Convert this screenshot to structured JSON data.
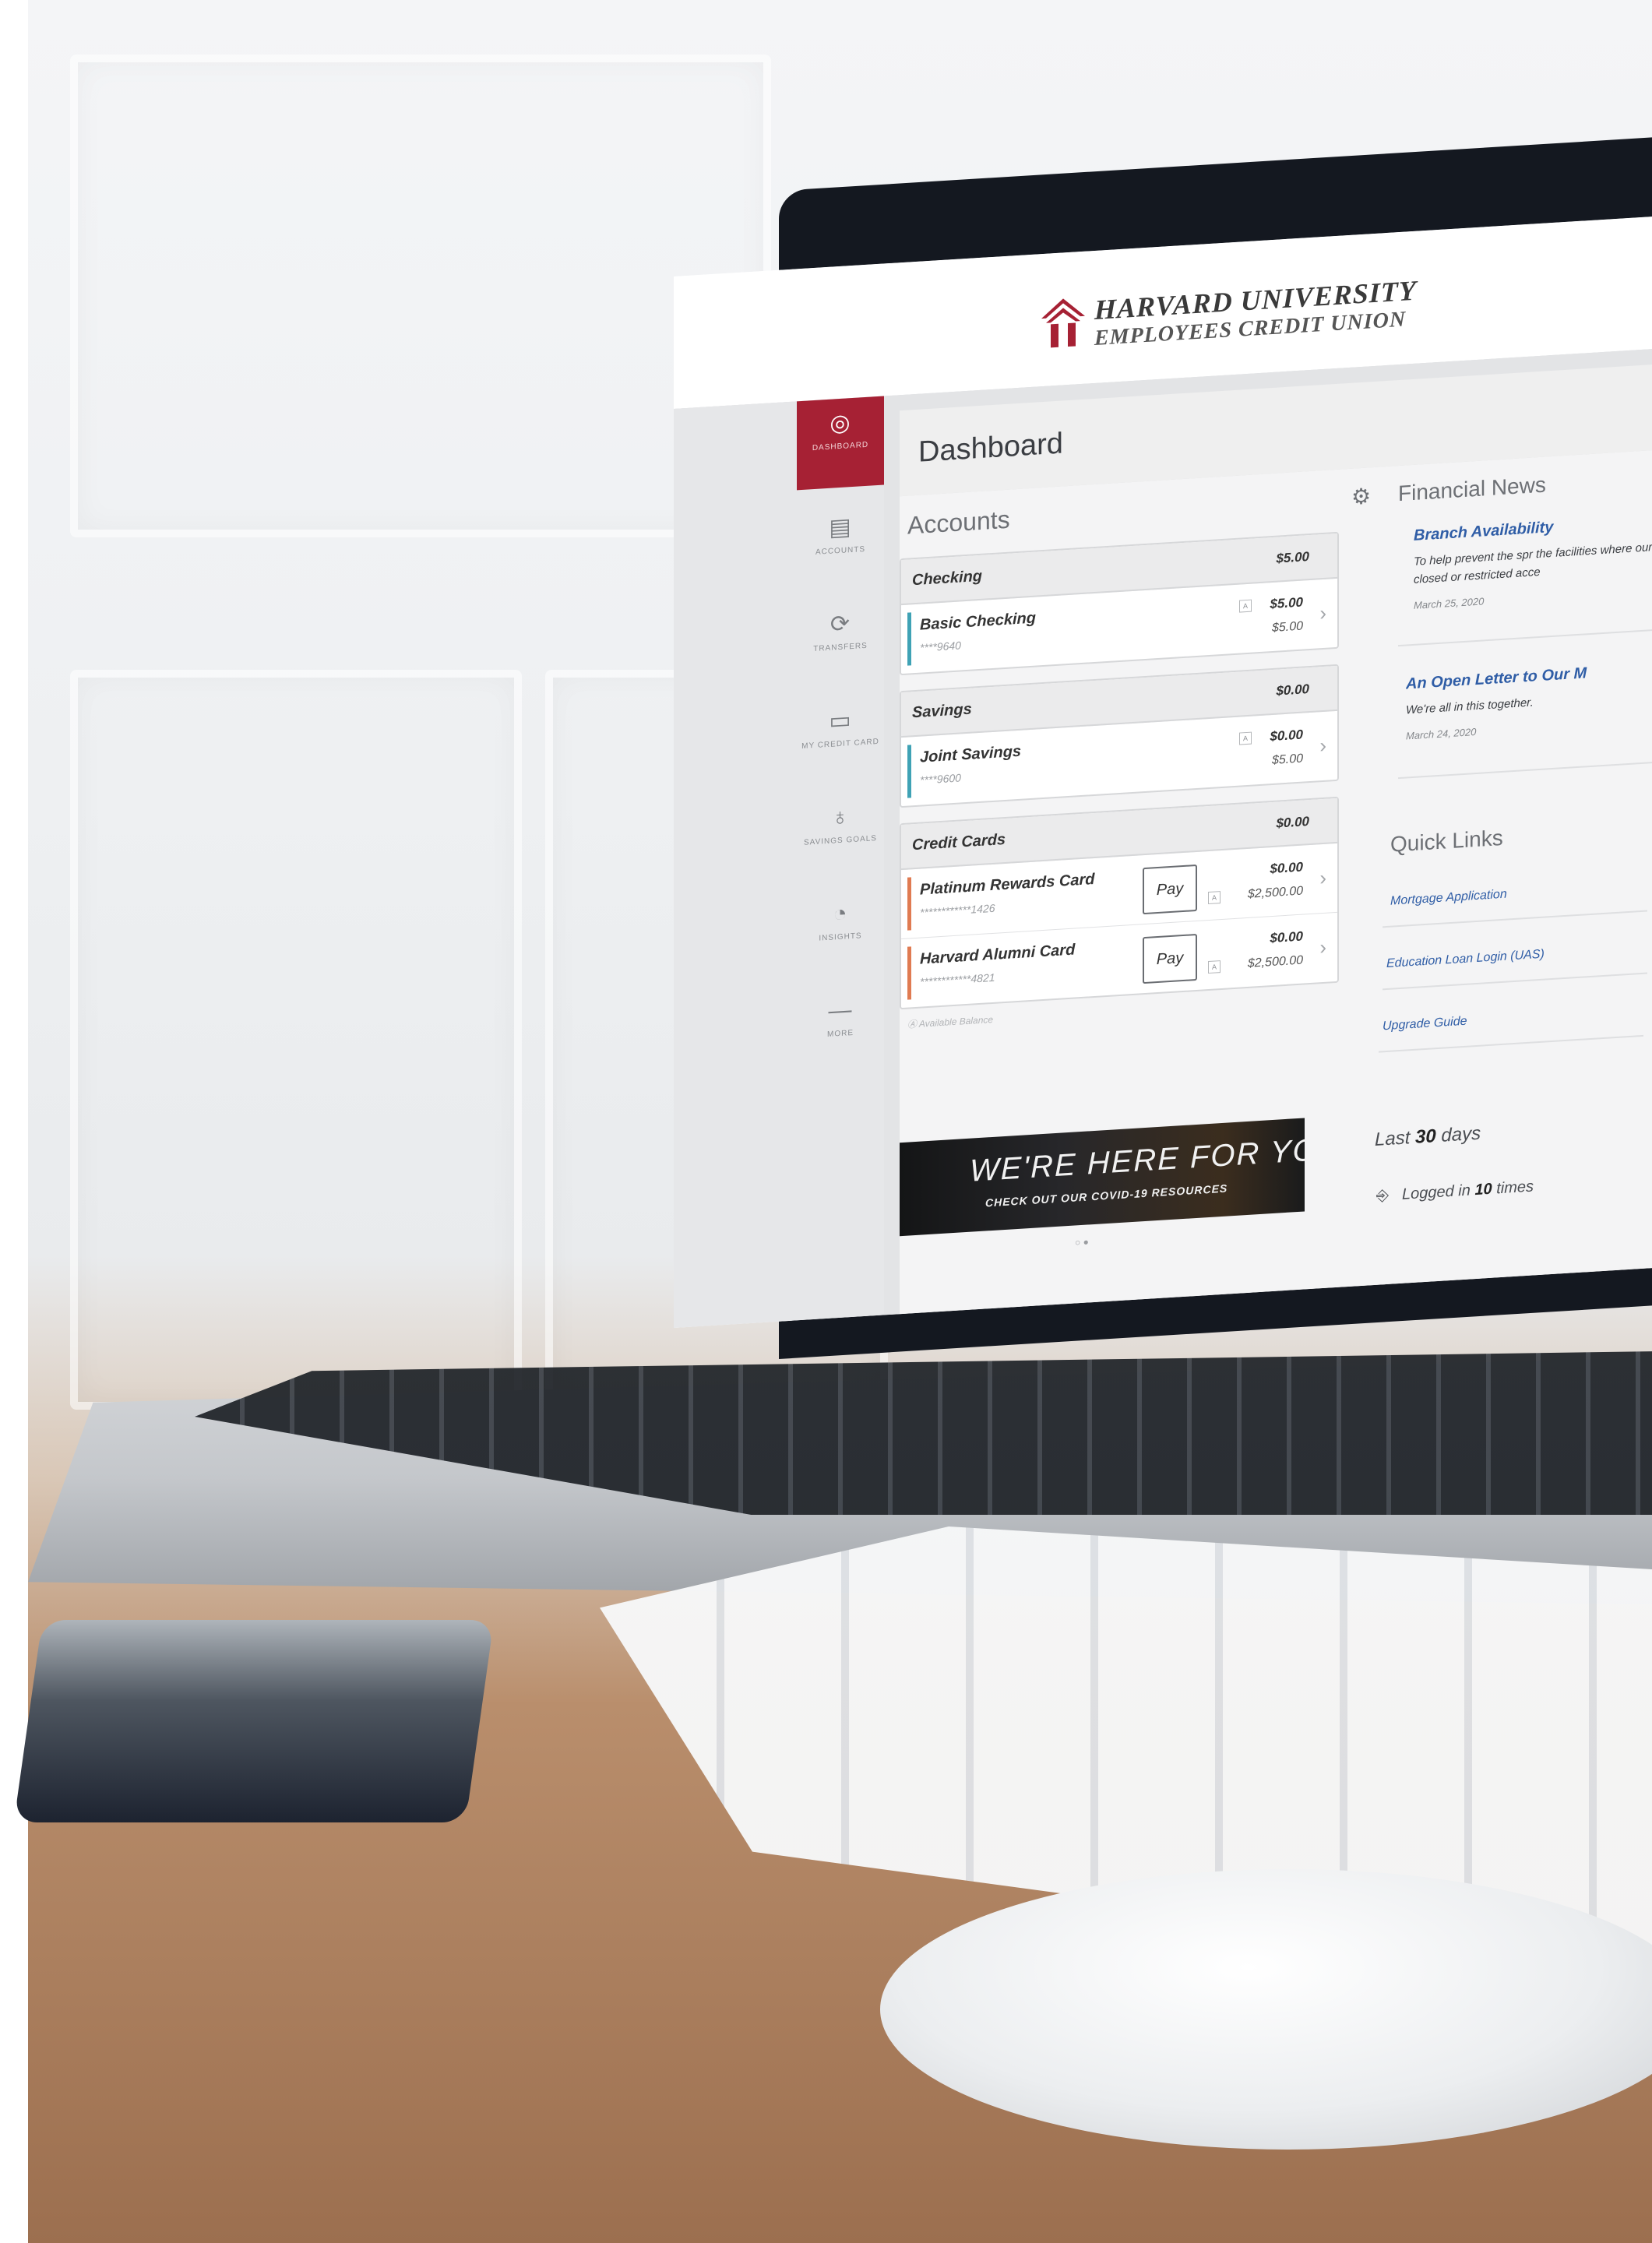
{
  "brand": {
    "line1": "HARVARD UNIVERSITY",
    "line2": "EMPLOYEES CREDIT UNION",
    "accent_color": "#a62134"
  },
  "sidebar": {
    "items": [
      {
        "label": "DASHBOARD",
        "icon": "dashboard-icon",
        "active": true
      },
      {
        "label": "ACCOUNTS",
        "icon": "accounts-icon",
        "active": false
      },
      {
        "label": "TRANSFERS",
        "icon": "transfers-icon",
        "active": false
      },
      {
        "label": "MY CREDIT CARD",
        "icon": "credit-card-icon",
        "active": false
      },
      {
        "label": "SAVINGS GOALS",
        "icon": "savings-goals-icon",
        "active": false
      },
      {
        "label": "INSIGHTS",
        "icon": "insights-icon",
        "active": false
      },
      {
        "label": "MORE",
        "icon": "more-icon",
        "active": false
      }
    ]
  },
  "page": {
    "title": "Dashboard"
  },
  "accounts": {
    "heading": "Accounts",
    "settings_icon": "gear-icon",
    "groups": [
      {
        "name": "Checking",
        "total": "$5.00",
        "rows": [
          {
            "name": "Basic Checking",
            "number": "****9640",
            "balance": "$5.00",
            "available": "$5.00",
            "color": "#3fa2b5"
          }
        ]
      },
      {
        "name": "Savings",
        "total": "$0.00",
        "rows": [
          {
            "name": "Joint Savings",
            "number": "****9600",
            "balance": "$0.00",
            "available": "$5.00",
            "color": "#3fa2b5"
          }
        ]
      },
      {
        "name": "Credit Cards",
        "total": "$0.00",
        "rows": [
          {
            "name": "Platinum Rewards Card",
            "number": "************1426",
            "balance": "$0.00",
            "available": "$2,500.00",
            "color": "#e07b52",
            "pay": "Pay"
          },
          {
            "name": "Harvard Alumni Card",
            "number": "************4821",
            "balance": "$0.00",
            "available": "$2,500.00",
            "color": "#e07b52",
            "pay": "Pay"
          }
        ]
      }
    ],
    "legend": "Available Balance"
  },
  "news": {
    "heading": "Financial News",
    "items": [
      {
        "title": "Branch Availability",
        "body": "To help prevent the spr the facilities where our closed or restricted acce",
        "date": "March 25, 2020"
      },
      {
        "title": "An Open Letter to Our M",
        "body": "We're all in this together.",
        "date": "March 24, 2020"
      }
    ]
  },
  "quick_links": {
    "heading": "Quick Links",
    "items": [
      "Mortgage Application",
      "Education Loan Login (UAS)",
      "Upgrade Guide"
    ]
  },
  "banner": {
    "title": "WE'RE HERE FOR YOU.",
    "subtitle": "CHECK OUT OUR COVID-19 RESOURCES"
  },
  "activity": {
    "prefix": "Last",
    "days": "30",
    "suffix": "days",
    "login_prefix": "Logged in",
    "login_count": "10",
    "login_suffix": "times"
  }
}
